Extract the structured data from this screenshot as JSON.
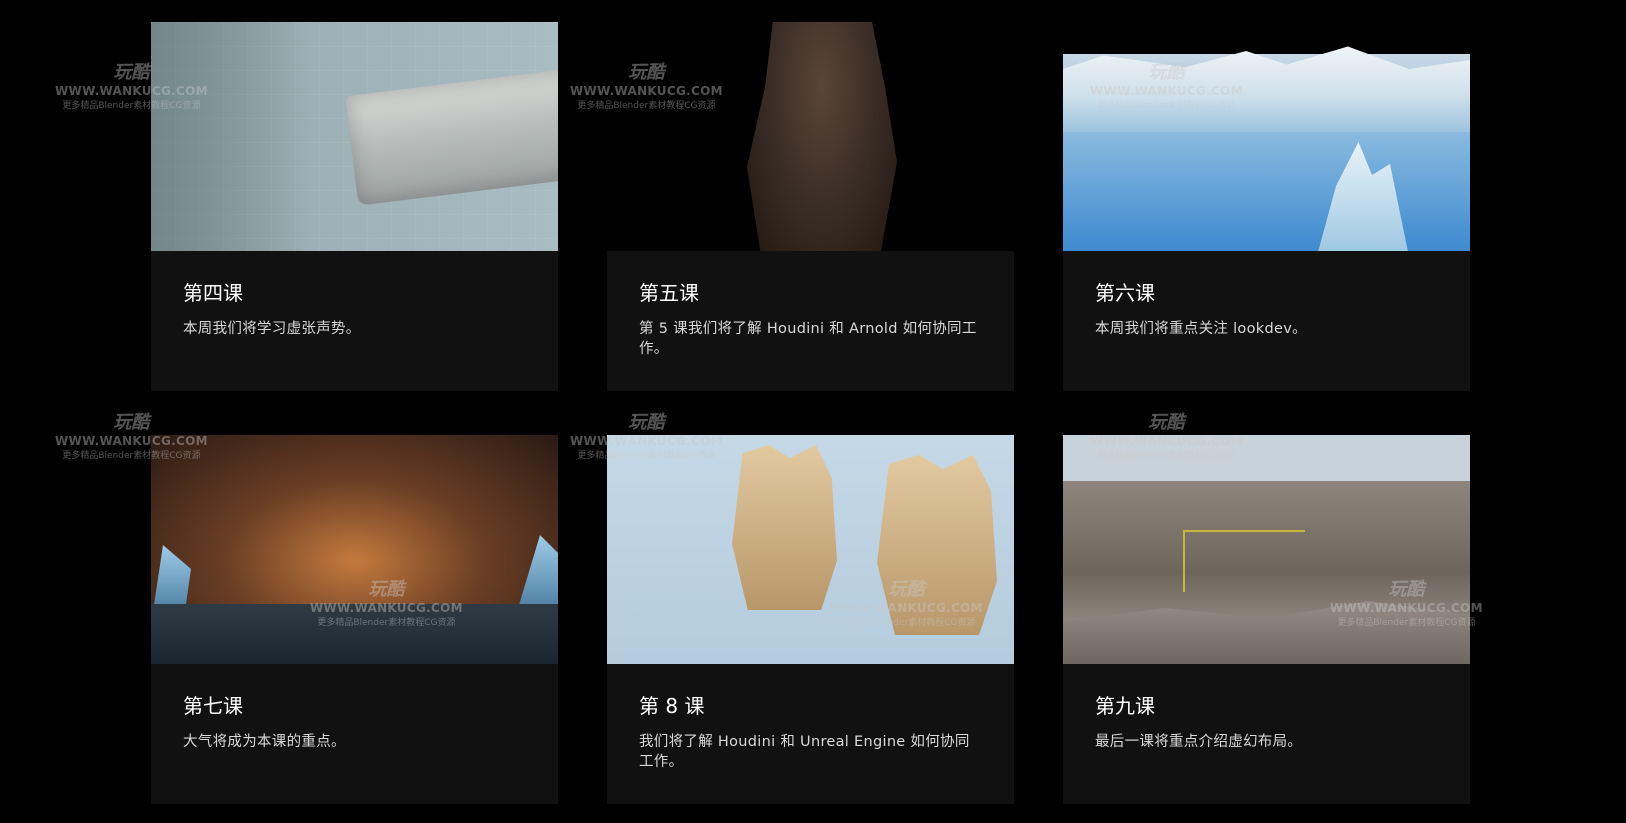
{
  "lessons": [
    {
      "title": "第四课",
      "description": "本周我们将学习虚张声势。"
    },
    {
      "title": "第五课",
      "description": "第 5 课我们将了解 Houdini 和 Arnold 如何协同工作。"
    },
    {
      "title": "第六课",
      "description": "本周我们将重点关注 lookdev。"
    },
    {
      "title": "第七课",
      "description": "大气将成为本课的重点。"
    },
    {
      "title": "第 8 课",
      "description": "我们将了解 Houdini 和 Unreal Engine 如何协同工作。"
    },
    {
      "title": "第九课",
      "description": "最后一课将重点介绍虚幻布局。"
    }
  ],
  "watermark": {
    "logo": "玩酷",
    "url": "WWW.WANKUCG.COM",
    "tagline": "更多精品Blender素材教程CG资源"
  }
}
